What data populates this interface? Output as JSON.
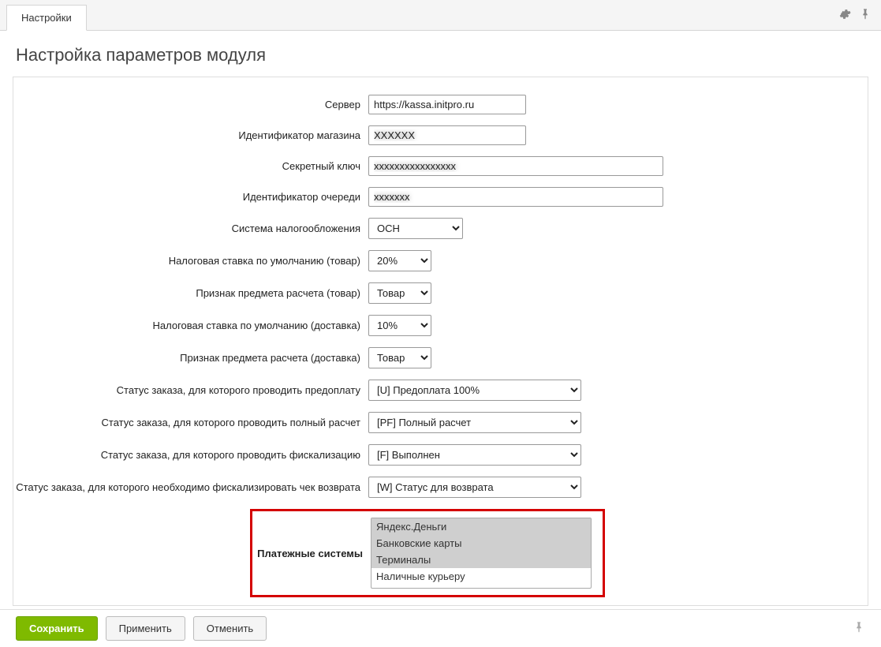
{
  "topbar": {
    "tab": "Настройки"
  },
  "page": {
    "title": "Настройка параметров модуля"
  },
  "form": {
    "server": {
      "label": "Сервер",
      "value": "https://kassa.initpro.ru"
    },
    "shop_id": {
      "label": "Идентификатор магазина",
      "value": "XXXXXX"
    },
    "secret_key": {
      "label": "Секретный ключ",
      "value": "xxxxxxxxxxxxxxxx"
    },
    "queue_id": {
      "label": "Идентификатор очереди",
      "value": "xxxxxxx"
    },
    "tax_system": {
      "label": "Система налогообложения",
      "value": "ОСН"
    },
    "vat_product": {
      "label": "Налоговая ставка по умолчанию (товар)",
      "value": "20%"
    },
    "subject_product": {
      "label": "Признак предмета расчета (товар)",
      "value": "Товар"
    },
    "vat_delivery": {
      "label": "Налоговая ставка по умолчанию (доставка)",
      "value": "10%"
    },
    "subject_delivery": {
      "label": "Признак предмета расчета (доставка)",
      "value": "Товар"
    },
    "status_prepay": {
      "label": "Статус заказа, для которого проводить предоплату",
      "value": "[U] Предоплата 100%"
    },
    "status_full": {
      "label": "Статус заказа, для которого проводить полный расчет",
      "value": "[PF] Полный расчет"
    },
    "status_fiscal": {
      "label": "Статус заказа, для которого проводить фискализацию",
      "value": "[F] Выполнен"
    },
    "status_refund": {
      "label": "Статус заказа, для которого необходимо фискализировать чек возврата",
      "value": "[W] Статус для возврата"
    },
    "payment_systems": {
      "label": "Платежные системы",
      "options": [
        {
          "text": "Яндекс.Деньги",
          "selected": true
        },
        {
          "text": "Банковские карты",
          "selected": true
        },
        {
          "text": "Терминалы",
          "selected": true
        },
        {
          "text": "Наличные курьеру",
          "selected": false
        }
      ]
    }
  },
  "actions": {
    "save": "Сохранить",
    "apply": "Применить",
    "cancel": "Отменить"
  }
}
